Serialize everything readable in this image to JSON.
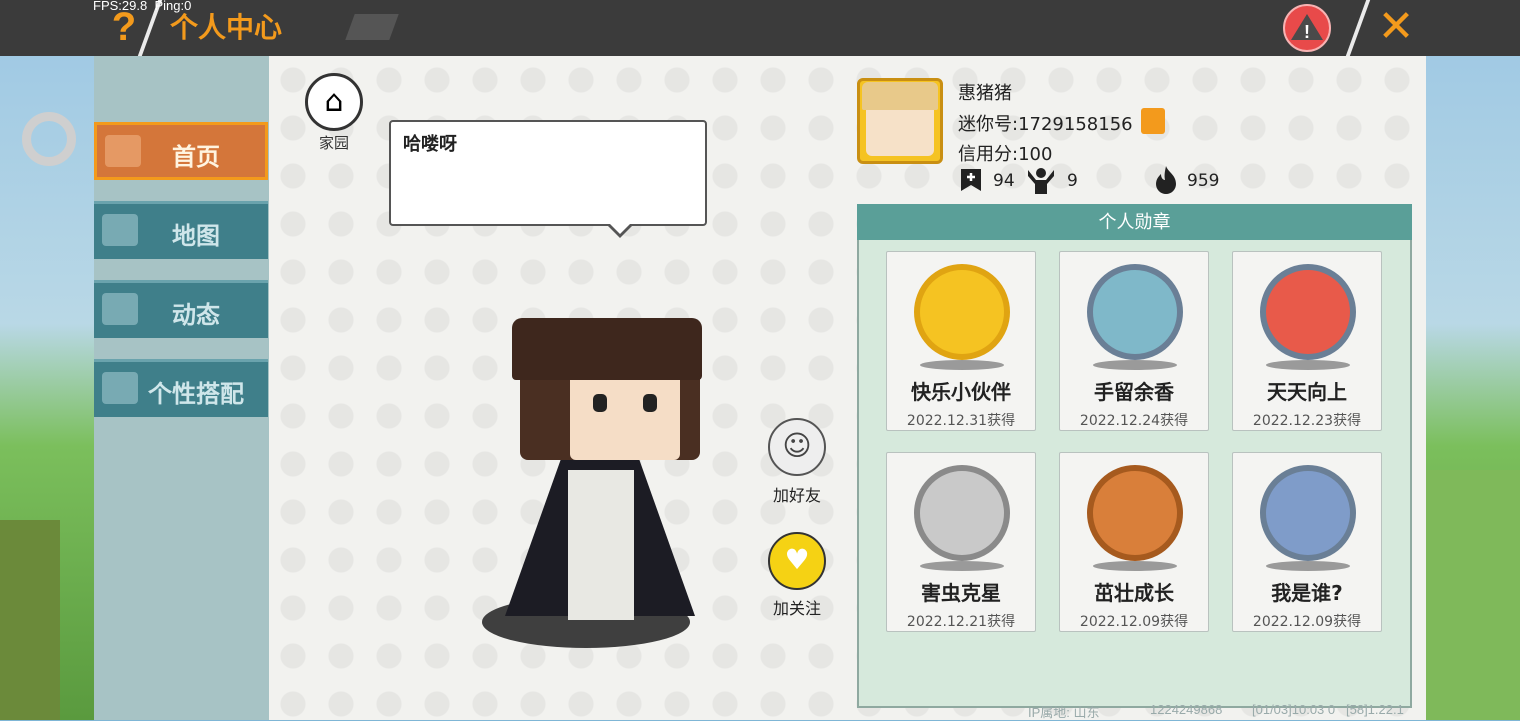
{
  "hud": {
    "fps": "FPS:29.8",
    "ping": "Ping:0"
  },
  "header": {
    "title": "个人中心",
    "help_icon": "?",
    "close_icon": "✕",
    "warning_icon": "!"
  },
  "sidebar": {
    "items": [
      {
        "label": "首页",
        "icon": "shirt-icon",
        "active": true
      },
      {
        "label": "地图",
        "icon": "map-icon",
        "active": false
      },
      {
        "label": "动态",
        "icon": "bell-icon",
        "active": false
      },
      {
        "label": "个性搭配",
        "icon": "avatar-icon",
        "active": false
      }
    ]
  },
  "home": {
    "label": "家园"
  },
  "bubble": {
    "text": "哈喽呀"
  },
  "actions": {
    "add_friend": "加好友",
    "follow": "加关注"
  },
  "profile": {
    "name": "惠猪猪",
    "mini_id_label": "迷你号:",
    "mini_id": "1729158156",
    "credit_label": "信用分:",
    "credit": "100",
    "stats": [
      {
        "icon": "bookmark-plus-icon",
        "value": "94"
      },
      {
        "icon": "cheer-icon",
        "value": "9"
      },
      {
        "icon": "flame-icon",
        "value": "959"
      }
    ]
  },
  "medals": {
    "header": "个人勋章",
    "items": [
      {
        "name": "快乐小伙伴",
        "date": "2022.12.31获得",
        "color": "#f5c322"
      },
      {
        "name": "手留余香",
        "date": "2022.12.24获得",
        "color": "#7fb8c9"
      },
      {
        "name": "天天向上",
        "date": "2022.12.23获得",
        "color": "#e85a4a"
      },
      {
        "name": "害虫克星",
        "date": "2022.12.21获得",
        "color": "#c9c9c9"
      },
      {
        "name": "茁壮成长",
        "date": "2022.12.09获得",
        "color": "#d97f3a"
      },
      {
        "name": "我是谁?",
        "date": "2022.12.09获得",
        "color": "#7f9cc9"
      }
    ]
  },
  "footer": {
    "ip": "IP属地: 山东",
    "uid": "1224249868",
    "time": "[01/03]10:03 0",
    "version": "[58]1.22.1"
  }
}
